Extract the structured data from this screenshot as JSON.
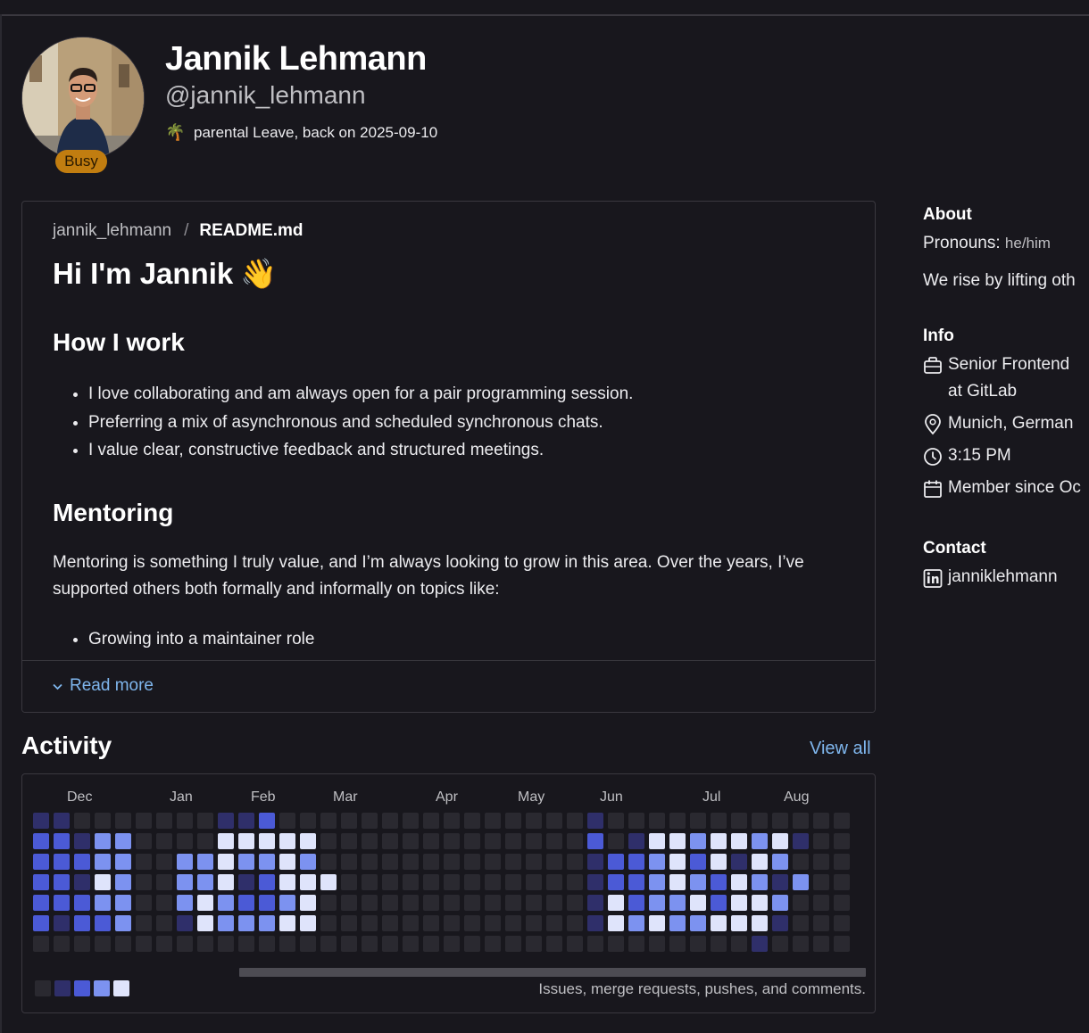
{
  "profile": {
    "name": "Jannik Lehmann",
    "handle": "@jannik_lehmann",
    "badge": "Busy",
    "status_emoji": "🌴",
    "status_text": "parental Leave, back on 2025-09-10"
  },
  "readme": {
    "breadcrumb_user": "jannik_lehmann",
    "breadcrumb_sep": "/",
    "breadcrumb_file": "README.md",
    "title": "Hi I'm Jannik",
    "title_emoji": "👋",
    "section1_heading": "How I work",
    "section1_items": [
      "I love collaborating and am always open for a pair programming session.",
      "Preferring a mix of asynchronous and scheduled synchronous chats.",
      "I value clear, constructive feedback and structured meetings."
    ],
    "section2_heading": "Mentoring",
    "section2_paragraph": "Mentoring is something I truly value, and I’m always looking to grow in this area. Over the years, I’ve supported others both formally and informally on topics like:",
    "section2_items": [
      "Growing into a maintainer role"
    ],
    "read_more": "Read more"
  },
  "activity": {
    "title": "Activity",
    "view_all": "View all",
    "months": [
      "Dec",
      "Jan",
      "Feb",
      "Mar",
      "Apr",
      "May",
      "Jun",
      "Jul",
      "Aug"
    ],
    "caption": "Issues, merge requests, pushes, and comments.",
    "colors": [
      "#2a2930",
      "#2f2f6a",
      "#4b5ad6",
      "#7c92f0",
      "#dfe4fb"
    ],
    "levels": [
      "1100000001120000000000000001000000000000",
      "2213300004444400000000000002014434434100",
      "2223300334334300000000000001223424143000",
      "2214300334124440000000000001223432431300",
      "2223300343223400000000000001423342443000",
      "2122300143334400000000000001434334441000",
      "0000000000000000000000000000000000010000"
    ]
  },
  "sidebar": {
    "about_heading": "About",
    "pronouns_label": "Pronouns:",
    "pronouns_value": "he/him",
    "bio": "We rise by lifting oth",
    "info_heading": "Info",
    "job_line1": "Senior Frontend",
    "job_line2": "at GitLab",
    "location": "Munich, German",
    "local_time": "3:15 PM",
    "member_since": "Member since Oc",
    "contact_heading": "Contact",
    "linkedin": "janniklehmann"
  }
}
